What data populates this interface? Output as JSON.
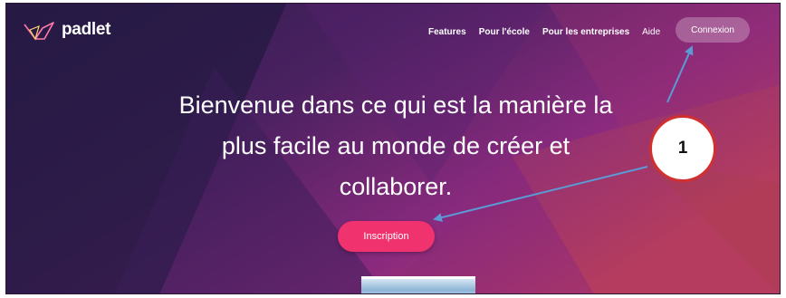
{
  "brand": {
    "name": "padlet"
  },
  "nav": {
    "items": [
      "Features",
      "Pour l'école",
      "Pour les entreprises",
      "Aide"
    ],
    "login_label": "Connexion"
  },
  "hero": {
    "headline_line1": "Bienvenue dans ce qui est la manière la",
    "headline_line2": "plus facile au monde de créer et",
    "headline_line3": "collaborer.",
    "signup_label": "Inscription"
  },
  "annotation": {
    "badge_number": "1",
    "arrow_color": "#5b9bd5",
    "badge_border": "#d32f2f"
  },
  "colors": {
    "accent": "#f0336e",
    "bg_dark": "#2e1b4e",
    "bg_purple": "#7a2a8a",
    "bg_pink": "#c0396b"
  }
}
